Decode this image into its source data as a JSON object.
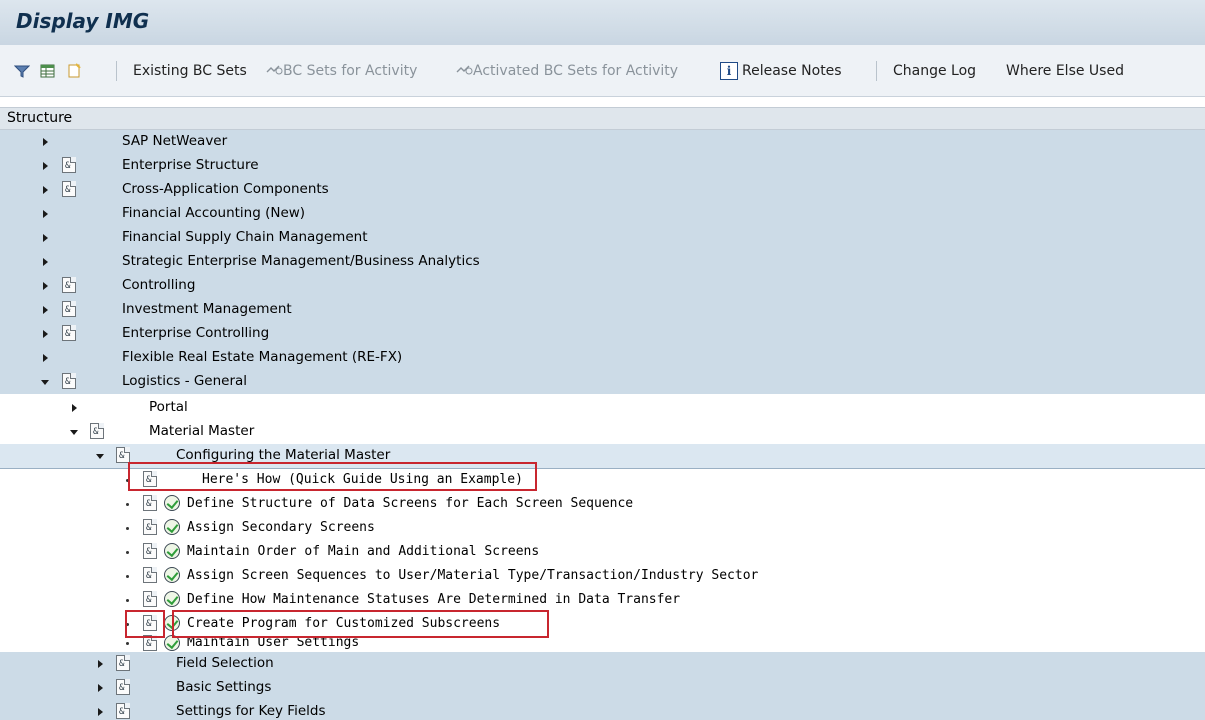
{
  "window": {
    "title": "Display IMG"
  },
  "toolbar": {
    "existing_bc_sets": "Existing BC Sets",
    "bc_sets_for_activity": "BC Sets for Activity",
    "activated_bc_sets": "Activated BC Sets for Activity",
    "info_glyph": "i",
    "release_notes": "Release Notes",
    "change_log": "Change Log",
    "where_else_used": "Where Else Used"
  },
  "structure": {
    "header": "Structure",
    "doc_glyph": "&",
    "items": [
      {
        "label": "SAP NetWeaver"
      },
      {
        "label": "Enterprise Structure"
      },
      {
        "label": "Cross-Application Components"
      },
      {
        "label": "Financial Accounting (New)"
      },
      {
        "label": "Financial Supply Chain Management"
      },
      {
        "label": "Strategic Enterprise Management/Business Analytics"
      },
      {
        "label": "Controlling"
      },
      {
        "label": "Investment Management"
      },
      {
        "label": "Enterprise Controlling"
      },
      {
        "label": "Flexible Real Estate Management (RE-FX)"
      },
      {
        "label": "Logistics - General"
      },
      {
        "label": "Portal"
      },
      {
        "label": "Material Master"
      },
      {
        "label": "Configuring the Material Master"
      },
      {
        "label": "Here's How (Quick Guide Using an Example)"
      },
      {
        "label": "Define Structure of Data Screens for Each Screen Sequence"
      },
      {
        "label": "Assign Secondary Screens"
      },
      {
        "label": "Maintain Order of Main and Additional Screens"
      },
      {
        "label": "Assign Screen Sequences to User/Material Type/Transaction/Industry Sector"
      },
      {
        "label": "Define How Maintenance Statuses Are Determined in Data Transfer"
      },
      {
        "label": "Create Program for Customized Subscreens"
      },
      {
        "label": "Maintain User Settings"
      },
      {
        "label": "Field Selection"
      },
      {
        "label": "Basic Settings"
      },
      {
        "label": "Settings for Key Fields"
      }
    ]
  },
  "colors": {
    "title_bar": "#c9d6e2",
    "tree_selected_bg": "#ccdbe7",
    "highlight_box": "#c8262f"
  }
}
